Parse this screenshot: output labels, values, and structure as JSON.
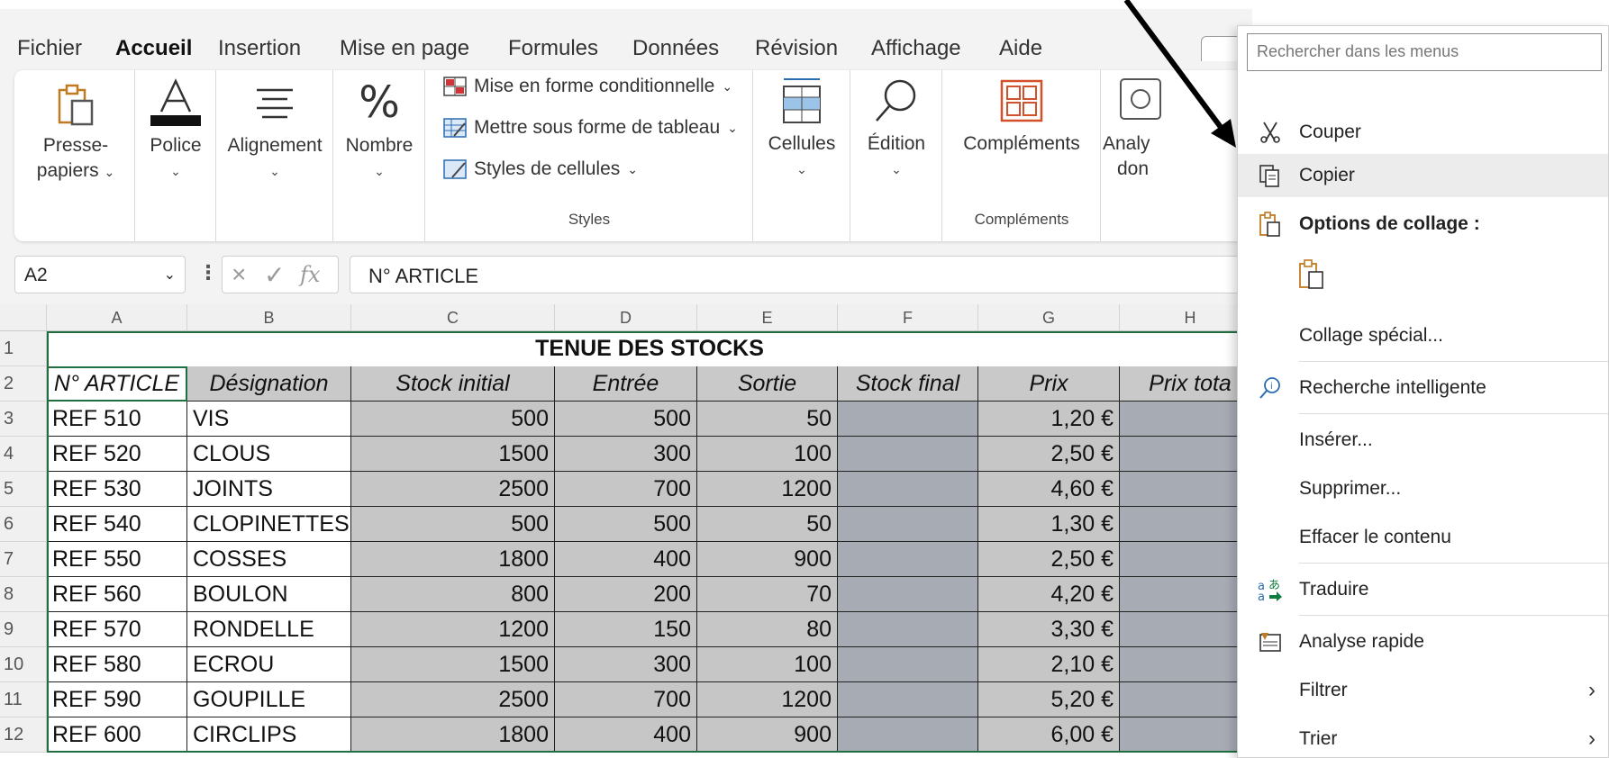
{
  "menu": {
    "tabs": [
      "Fichier",
      "Accueil",
      "Insertion",
      "Mise en page",
      "Formules",
      "Données",
      "Révision",
      "Affichage",
      "Aide"
    ],
    "active_tab": "Accueil"
  },
  "ribbon": {
    "clipboard_l1": "Presse-",
    "clipboard_l2": "papiers",
    "font": "Police",
    "alignment": "Alignement",
    "number": "Nombre",
    "cond_format": "Mise en forme conditionnelle",
    "format_table": "Mettre sous forme de tableau",
    "cell_styles": "Styles de cellules",
    "styles_group": "Styles",
    "cells": "Cellules",
    "editing": "Édition",
    "addins": "Compléments",
    "addins_group": "Compléments",
    "analysis_l1": "Analy",
    "analysis_l2": "don"
  },
  "formula_bar": {
    "name_box": "A2",
    "fx": "fx",
    "value": "N° ARTICLE"
  },
  "sheet": {
    "columns": [
      "A",
      "B",
      "C",
      "D",
      "E",
      "F",
      "G",
      "H"
    ],
    "rows": [
      "1",
      "2",
      "3",
      "4",
      "5",
      "6",
      "7",
      "8",
      "9",
      "10",
      "11",
      "12"
    ],
    "title": "TENUE DES STOCKS",
    "headers": [
      "N° ARTICLE",
      "Désignation",
      "Stock initial",
      "Entrée",
      "Sortie",
      "Stock final",
      "Prix",
      "Prix tota"
    ],
    "data": [
      [
        "REF 510",
        "VIS",
        "500",
        "500",
        "50",
        "",
        "1,20 €",
        ""
      ],
      [
        "REF 520",
        "CLOUS",
        "1500",
        "300",
        "100",
        "",
        "2,50 €",
        ""
      ],
      [
        "REF 530",
        "JOINTS",
        "2500",
        "700",
        "1200",
        "",
        "4,60 €",
        ""
      ],
      [
        "REF 540",
        "CLOPINETTES",
        "500",
        "500",
        "50",
        "",
        "1,30 €",
        ""
      ],
      [
        "REF 550",
        "COSSES",
        "1800",
        "400",
        "900",
        "",
        "2,50 €",
        ""
      ],
      [
        "REF 560",
        "BOULON",
        "800",
        "200",
        "70",
        "",
        "4,20 €",
        ""
      ],
      [
        "REF 570",
        "RONDELLE",
        "1200",
        "150",
        "80",
        "",
        "3,30 €",
        ""
      ],
      [
        "REF 580",
        "ECROU",
        "1500",
        "300",
        "100",
        "",
        "2,10 €",
        ""
      ],
      [
        "REF 590",
        "GOUPILLE",
        "2500",
        "700",
        "1200",
        "",
        "5,20 €",
        ""
      ],
      [
        "REF 600",
        "CIRCLIPS",
        "1800",
        "400",
        "900",
        "",
        "6,00 €",
        ""
      ]
    ]
  },
  "context_menu": {
    "search_placeholder": "Rechercher dans les menus",
    "items": [
      {
        "label": "Couper",
        "icon": "scissors-icon"
      },
      {
        "label": "Copier",
        "icon": "copy-icon"
      },
      {
        "label": "Options de collage :",
        "icon": "paste-options-icon"
      },
      {
        "label": "",
        "icon": "paste-icon"
      },
      {
        "label": "Collage spécial...",
        "icon": ""
      },
      {
        "label": "Recherche intelligente",
        "icon": "smart-lookup-icon"
      },
      {
        "label": "Insérer...",
        "icon": ""
      },
      {
        "label": "Supprimer...",
        "icon": ""
      },
      {
        "label": "Effacer le contenu",
        "icon": ""
      },
      {
        "label": "Traduire",
        "icon": "translate-icon"
      },
      {
        "label": "Analyse rapide",
        "icon": "quick-analysis-icon"
      },
      {
        "label": "Filtrer",
        "icon": ""
      },
      {
        "label": "Trier",
        "icon": ""
      }
    ]
  },
  "colors": {
    "accent": "#107c41",
    "data_fill": "#c6c6c6",
    "calc_fill": "#a7abb4",
    "ribbon_bg": "#f3f3f3"
  }
}
